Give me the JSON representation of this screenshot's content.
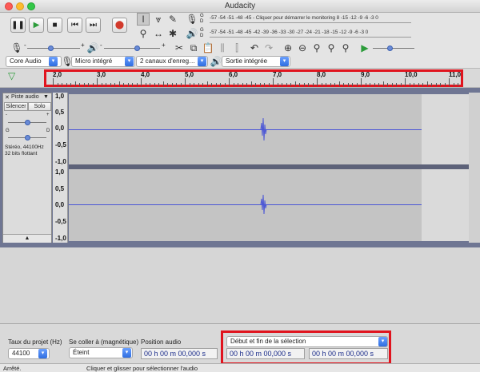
{
  "window": {
    "title": "Audacity"
  },
  "transport": {
    "icons": [
      "pause-icon",
      "play-icon",
      "stop-icon",
      "skip-start-icon",
      "skip-end-icon",
      "record-icon"
    ]
  },
  "meters": {
    "record_channel_left": "G",
    "record_channel_right": "D",
    "play_channel_left": "G",
    "play_channel_right": "D",
    "record_scale": "-57 -54 -51 -48 -45 - Cliquer pour démarrer le monitoring 8 -15 -12 -9 -6 -3 0",
    "play_scale": "-57 -54 -51 -48 -45 -42 -39 -36 -33 -30 -27 -24 -21 -18 -15 -12 -9 -6 -3 0"
  },
  "mixer": {
    "minus": "-",
    "plus": "+"
  },
  "devices": {
    "host": "Core Audio",
    "input": "Micro intégré",
    "channels": "2 canaux d'enreg…",
    "output": "Sortie intégrée"
  },
  "timeline": {
    "ticks": [
      "2,0",
      "3,0",
      "4,0",
      "5,0",
      "6,0",
      "7,0",
      "8,0",
      "9,0",
      "10,0",
      "11,0"
    ]
  },
  "track": {
    "name": "Piste audio",
    "mute": "Silencer",
    "solo": "Solo",
    "pan_left": "G",
    "pan_right": "D",
    "info_line1": "Stéréo, 44100Hz",
    "info_line2": "32 bits flottant",
    "scale_top": [
      "1,0",
      "0,5",
      "0,0",
      "-0,5",
      "-1,0"
    ],
    "scale_bottom": [
      "1,0",
      "0,5",
      "0,0",
      "-0,5",
      "-1,0"
    ]
  },
  "bottom": {
    "rate_label": "Taux du projet (Hz)",
    "rate_value": "44100",
    "snap_label": "Se coller à (magnétique)",
    "snap_value": "Éteint",
    "position_label": "Position audio",
    "position_value": "00 h 00 m 00,000 s",
    "selection_mode": "Début et fin de la sélection",
    "selection_start": "00 h 00 m 00,000 s",
    "selection_end": "00 h 00 m 00,000 s"
  },
  "status": {
    "state": "Arrêté.",
    "hint": "Cliquer et glisser pour sélectionner l'audio"
  },
  "colors": {
    "highlight": "#e0141e",
    "waveform": "#4b56d6",
    "accent": "#2f6de0"
  }
}
